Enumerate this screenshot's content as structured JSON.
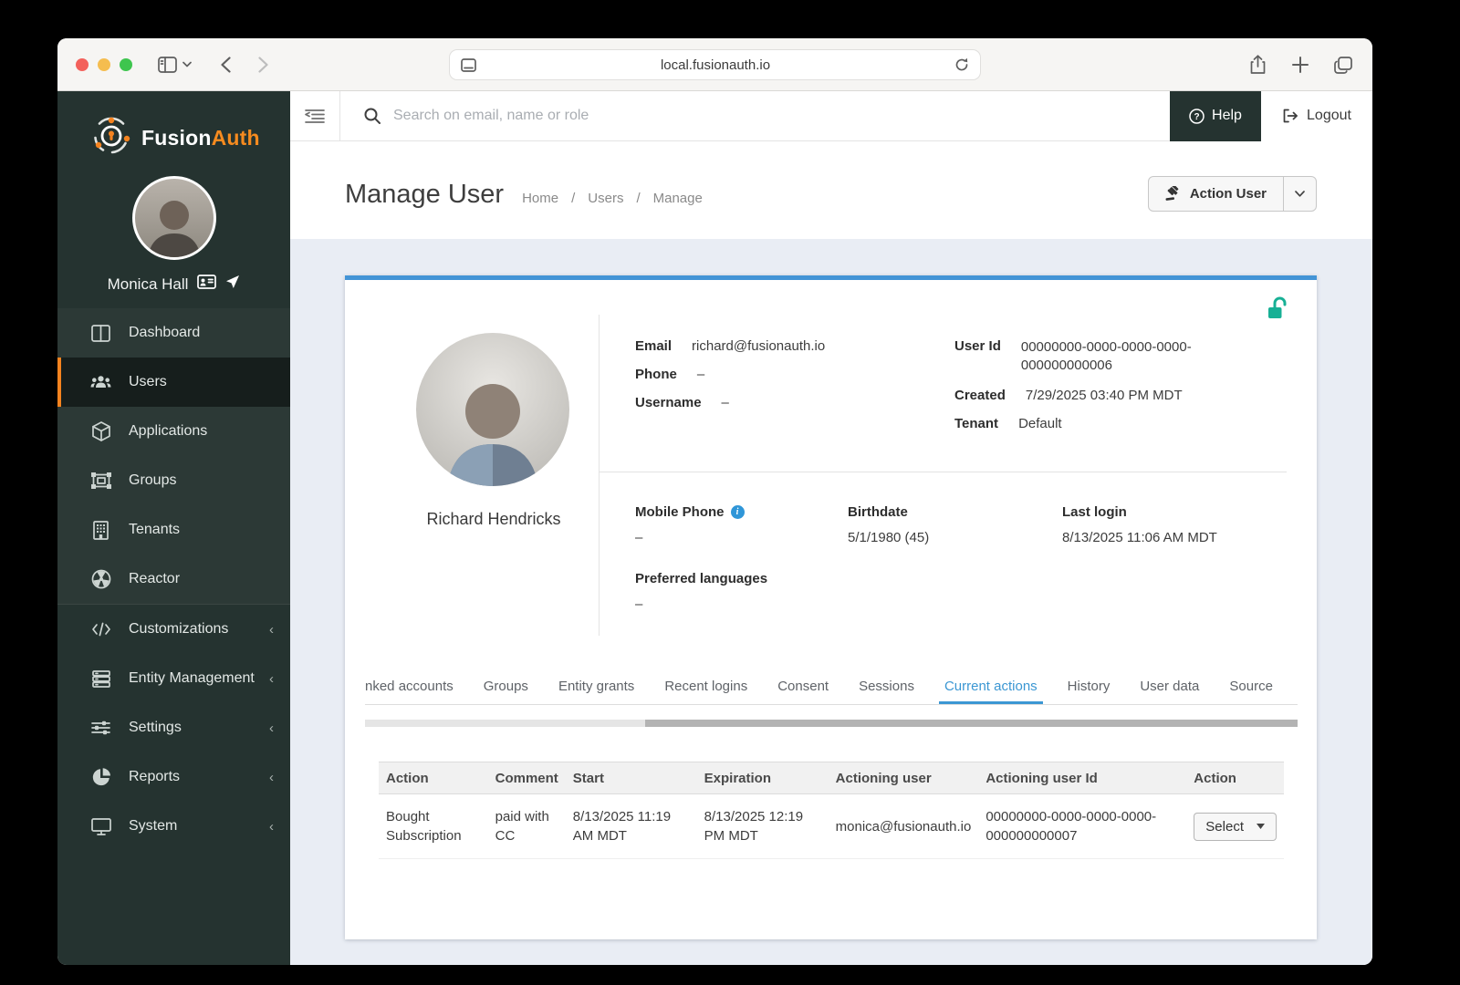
{
  "browser": {
    "url": "local.fusionauth.io",
    "traffic_lights": {
      "red": "#f3615b",
      "yellow": "#f5bd4f",
      "green": "#3ec54e"
    }
  },
  "sidebar": {
    "brand": {
      "name_primary": "Fusion",
      "name_secondary": "Auth"
    },
    "profile": {
      "name": "Monica Hall"
    },
    "active_index": 1,
    "nav": [
      {
        "label": "Dashboard",
        "icon": "dashboard-icon"
      },
      {
        "label": "Users",
        "icon": "users-icon"
      },
      {
        "label": "Applications",
        "icon": "cube-icon"
      },
      {
        "label": "Groups",
        "icon": "object-group-icon"
      },
      {
        "label": "Tenants",
        "icon": "building-icon"
      },
      {
        "label": "Reactor",
        "icon": "radiation-icon"
      },
      {
        "label": "Customizations",
        "icon": "code-icon",
        "expandable": true
      },
      {
        "label": "Entity Management",
        "icon": "server-icon",
        "expandable": true
      },
      {
        "label": "Settings",
        "icon": "sliders-icon",
        "expandable": true
      },
      {
        "label": "Reports",
        "icon": "pie-chart-icon",
        "expandable": true
      },
      {
        "label": "System",
        "icon": "monitor-icon",
        "expandable": true
      }
    ]
  },
  "topbar": {
    "search_placeholder": "Search on email, name or role",
    "help_label": "Help",
    "logout_label": "Logout"
  },
  "page": {
    "title": "Manage User",
    "breadcrumb": {
      "0": "Home",
      "1": "Users",
      "2": "Manage",
      "separator": "/"
    },
    "action_button_label": "Action User"
  },
  "user": {
    "name": "Richard Hendricks",
    "email_label": "Email",
    "email": "richard@fusionauth.io",
    "phone_label": "Phone",
    "phone": "–",
    "username_label": "Username",
    "username": "–",
    "user_id_label": "User Id",
    "user_id": "00000000-0000-0000-0000-000000000006",
    "created_label": "Created",
    "created": "7/29/2025 03:40 PM MDT",
    "tenant_label": "Tenant",
    "tenant": "Default",
    "mobile_label": "Mobile Phone",
    "mobile": "–",
    "birthdate_label": "Birthdate",
    "birthdate": "5/1/1980 (45)",
    "last_login_label": "Last login",
    "last_login": "8/13/2025 11:06 AM MDT",
    "languages_label": "Preferred languages",
    "languages": "–"
  },
  "tabs": {
    "active_index": 6,
    "items": [
      {
        "label": "nked accounts"
      },
      {
        "label": "Groups"
      },
      {
        "label": "Entity grants"
      },
      {
        "label": "Recent logins"
      },
      {
        "label": "Consent"
      },
      {
        "label": "Sessions"
      },
      {
        "label": "Current actions"
      },
      {
        "label": "History"
      },
      {
        "label": "User data"
      },
      {
        "label": "Source"
      }
    ]
  },
  "actions_table": {
    "headers": [
      "Action",
      "Comment",
      "Start",
      "Expiration",
      "Actioning user",
      "Actioning user Id",
      "Action"
    ],
    "rows": [
      {
        "action": "Bought Subscription",
        "comment": "paid with CC",
        "start": "8/13/2025 11:19 AM MDT",
        "expiration": "8/13/2025 12:19 PM MDT",
        "actioning_user": "monica@fusionauth.io",
        "actioning_user_id": "00000000-0000-0000-0000-000000000007",
        "select_label": "Select"
      }
    ]
  },
  "colors": {
    "accent_orange": "#f5831f",
    "accent_blue": "#3b97d3",
    "card_top_border": "#4394d6",
    "unlock_teal": "#17b095",
    "sidebar_bg": "#253330"
  }
}
